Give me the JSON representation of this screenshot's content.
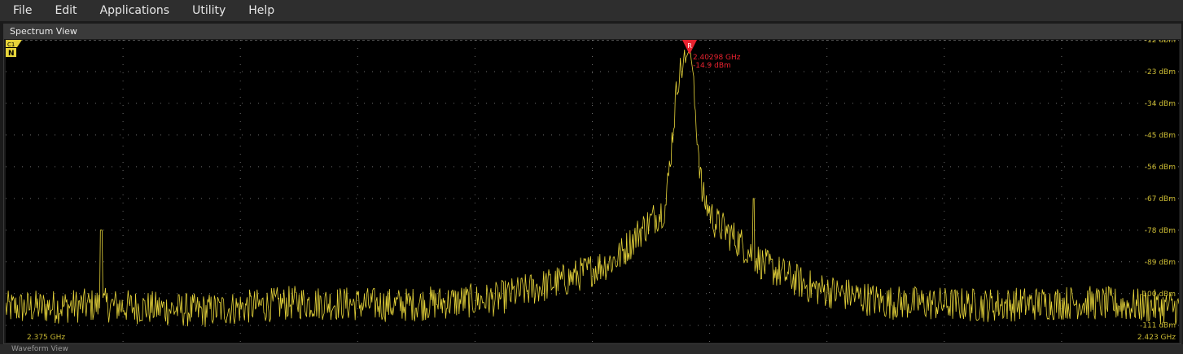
{
  "menu": [
    "File",
    "Edit",
    "Applications",
    "Utility",
    "Help"
  ],
  "panel": {
    "title": "Spectrum View"
  },
  "channel_badge": {
    "channel": "C1",
    "mode": "N",
    "color": "#e6d43a"
  },
  "marker": {
    "label": "R",
    "frequency": "2.40298 GHz",
    "level": "-14.9 dBm",
    "color": "#e8222f"
  },
  "colors": {
    "trace": "#e6d43a",
    "grid": "#6a6a6a",
    "axis_text": "#c8b832"
  },
  "chart_data": {
    "type": "line",
    "xlabel": "",
    "ylabel": "",
    "x_start_label": "2.375 GHz",
    "x_stop_label": "2.423 GHz",
    "xlim": [
      2.375,
      2.423
    ],
    "ylim": [
      -117,
      -12
    ],
    "y_tick_labels": [
      "-12 dBm",
      "-23 dBm",
      "-34 dBm",
      "-45 dBm",
      "-56 dBm",
      "-67 dBm",
      "-78 dBm",
      "-89 dBm",
      "-100 dBm",
      "-111 dBm"
    ],
    "y_ticks": [
      -12,
      -23,
      -34,
      -45,
      -56,
      -67,
      -78,
      -89,
      -100,
      -111
    ],
    "grid": true,
    "series": [
      {
        "x": [
          2.375,
          2.379,
          2.383,
          2.387,
          2.391,
          2.395,
          2.398,
          2.4,
          2.401,
          2.402,
          2.4025,
          2.403,
          2.4035,
          2.404,
          2.405,
          2.406,
          2.408,
          2.411,
          2.415,
          2.419,
          2.423
        ],
        "y": [
          -105,
          -104,
          -106,
          -103,
          -104,
          -102,
          -95,
          -88,
          -78,
          -70,
          -25,
          -14.9,
          -66,
          -75,
          -82,
          -90,
          -98,
          -103,
          -104,
          -103,
          -105
        ]
      }
    ],
    "spurs": [
      {
        "x": 2.3789,
        "y": -78
      },
      {
        "x": 2.4056,
        "y": -67
      }
    ],
    "annotations": [
      "2.40298 GHz",
      "-14.9 dBm"
    ]
  },
  "bottom_bar": {
    "label": "Waveform View"
  }
}
